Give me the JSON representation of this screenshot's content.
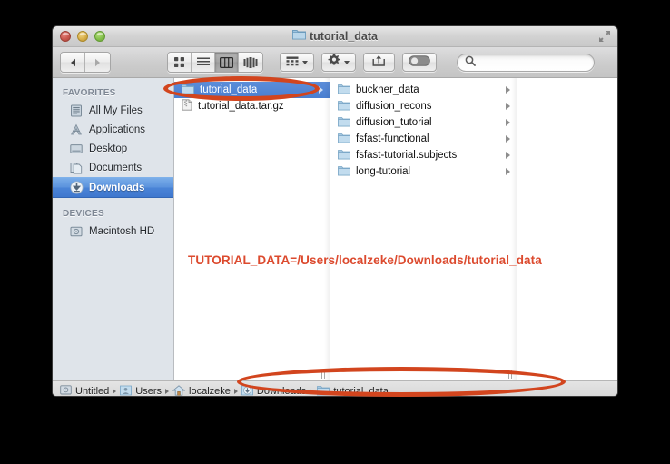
{
  "window": {
    "title": "tutorial_data",
    "title_icon": "folder-icon",
    "traffic_lights": [
      "close-button",
      "minimize-button",
      "zoom-button"
    ],
    "fullscreen_icon": "fullscreen-arrows-icon"
  },
  "toolbar": {
    "back_label": "◀",
    "forward_label": "▶",
    "view_modes": [
      {
        "name": "icon-view",
        "label": "icon",
        "active": false
      },
      {
        "name": "list-view",
        "label": "list",
        "active": false
      },
      {
        "name": "column-view",
        "label": "column",
        "active": true
      },
      {
        "name": "coverflow-view",
        "label": "coverflow",
        "active": false
      }
    ],
    "arrange_icon": "arrange-grid-icon",
    "action_icon": "gear-icon",
    "share_icon": "share-arrow-icon",
    "tags_icon": "edit-tags-toggle-icon",
    "search_placeholder": ""
  },
  "sidebar": {
    "sections": [
      {
        "header": "FAVORITES",
        "items": [
          {
            "label": "All My Files",
            "icon": "all-my-files-icon",
            "selected": false
          },
          {
            "label": "Applications",
            "icon": "applications-icon",
            "selected": false
          },
          {
            "label": "Desktop",
            "icon": "desktop-icon",
            "selected": false
          },
          {
            "label": "Documents",
            "icon": "documents-icon",
            "selected": false
          },
          {
            "label": "Downloads",
            "icon": "downloads-icon",
            "selected": true
          }
        ]
      },
      {
        "header": "DEVICES",
        "items": [
          {
            "label": "Macintosh HD",
            "icon": "hard-disk-icon",
            "selected": false
          }
        ]
      }
    ]
  },
  "columns": [
    {
      "name": "column-downloads",
      "items": [
        {
          "label": "tutorial_data",
          "icon": "folder-icon",
          "selected": true,
          "has_children": true
        },
        {
          "label": "tutorial_data.tar.gz",
          "icon": "archive-file-icon",
          "selected": false,
          "has_children": false
        }
      ]
    },
    {
      "name": "column-tutorial-data",
      "items": [
        {
          "label": "buckner_data",
          "icon": "folder-icon",
          "selected": false,
          "has_children": true
        },
        {
          "label": "diffusion_recons",
          "icon": "folder-icon",
          "selected": false,
          "has_children": true
        },
        {
          "label": "diffusion_tutorial",
          "icon": "folder-icon",
          "selected": false,
          "has_children": true
        },
        {
          "label": "fsfast-functional",
          "icon": "folder-icon",
          "selected": false,
          "has_children": true
        },
        {
          "label": "fsfast-tutorial.subjects",
          "icon": "folder-icon",
          "selected": false,
          "has_children": true
        },
        {
          "label": "long-tutorial",
          "icon": "folder-icon",
          "selected": false,
          "has_children": true
        }
      ]
    },
    {
      "name": "column-preview",
      "items": []
    }
  ],
  "annotation": {
    "text": "TUTORIAL_DATA=/Users/localzeke/Downloads/tutorial_data",
    "color": "#dc4a2e",
    "highlight_color": "#d2451e",
    "ovals": [
      "oval-around-tutorial-data-folder",
      "oval-around-path-bar"
    ]
  },
  "pathbar": {
    "crumbs": [
      {
        "label": "Untitled",
        "icon": "hard-disk-icon"
      },
      {
        "label": "Users",
        "icon": "users-folder-icon"
      },
      {
        "label": "localzeke",
        "icon": "home-folder-icon"
      },
      {
        "label": "Downloads",
        "icon": "downloads-folder-icon"
      },
      {
        "label": "tutorial_data",
        "icon": "folder-icon"
      }
    ]
  }
}
